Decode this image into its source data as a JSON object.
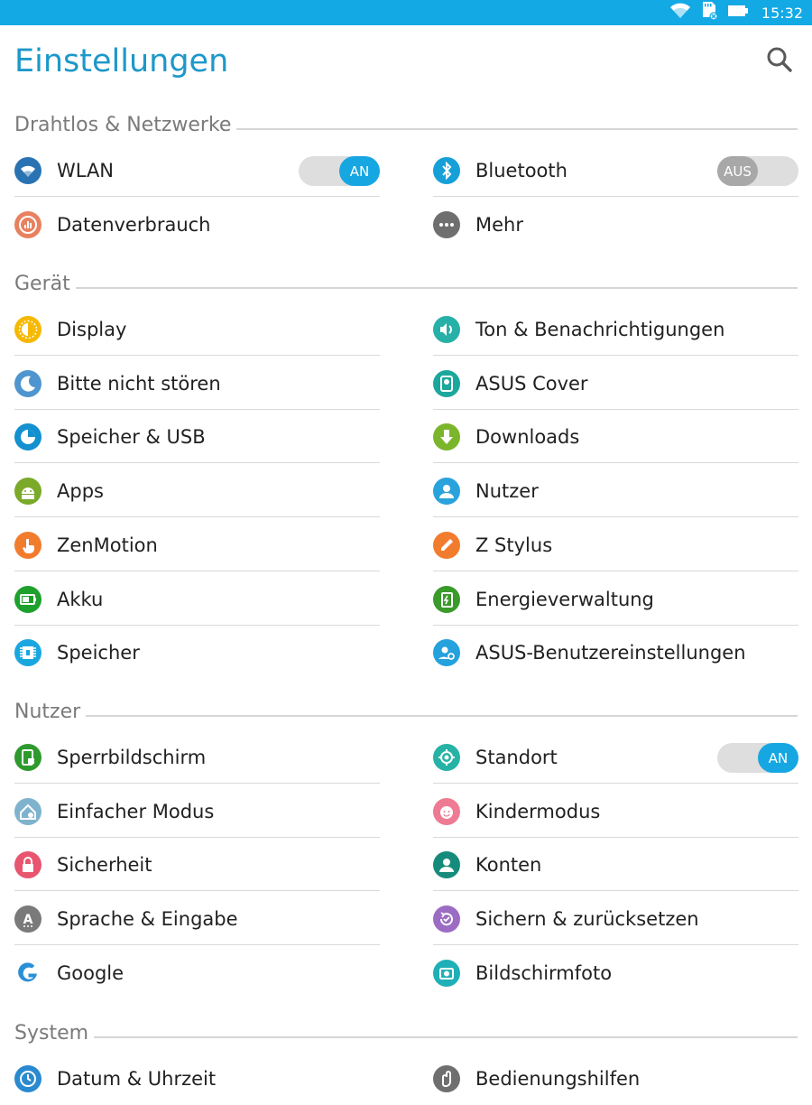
{
  "status_bar": {
    "time": "15:32",
    "icons": [
      "wifi-icon",
      "sd-card-icon",
      "battery-icon"
    ],
    "color": "#12a9e5"
  },
  "app_bar": {
    "title": "Einstellungen",
    "search_icon": "search-icon"
  },
  "sections": [
    {
      "title": "Drahtlos & Netzwerke",
      "items": [
        {
          "label": "WLAN",
          "icon": "wifi-icon",
          "color": "#2a73b3",
          "toggle": {
            "state": "on",
            "text": "AN"
          }
        },
        {
          "label": "Bluetooth",
          "icon": "bluetooth-icon",
          "color": "#16a0d7",
          "toggle": {
            "state": "off",
            "text": "AUS"
          }
        },
        {
          "label": "Datenverbrauch",
          "icon": "data-usage-icon",
          "color": "#e8815f"
        },
        {
          "label": "Mehr",
          "icon": "more-icon",
          "color": "#6f6f6f"
        }
      ]
    },
    {
      "title": "Gerät",
      "items": [
        {
          "label": "Display",
          "icon": "display-icon",
          "color": "#f6b800"
        },
        {
          "label": "Ton & Benachrichtigungen",
          "icon": "sound-icon",
          "color": "#26b0a8"
        },
        {
          "label": "Bitte nicht stören",
          "icon": "moon-icon",
          "color": "#4f95cf"
        },
        {
          "label": "ASUS Cover",
          "icon": "asus-cover-icon",
          "color": "#1ba79c"
        },
        {
          "label": "Speicher & USB",
          "icon": "storage-usb-icon",
          "color": "#1390cf"
        },
        {
          "label": "Downloads",
          "icon": "download-icon",
          "color": "#7bb52b"
        },
        {
          "label": "Apps",
          "icon": "android-icon",
          "color": "#7ba92a"
        },
        {
          "label": "Nutzer",
          "icon": "user-icon",
          "color": "#2aa2dc"
        },
        {
          "label": "ZenMotion",
          "icon": "zenmotion-icon",
          "color": "#f27c2d"
        },
        {
          "label": "Z Stylus",
          "icon": "stylus-icon",
          "color": "#f27c2d"
        },
        {
          "label": "Akku",
          "icon": "battery-icon",
          "color": "#1ea02c"
        },
        {
          "label": "Energieverwaltung",
          "icon": "power-management-icon",
          "color": "#3a9a2a"
        },
        {
          "label": "Speicher",
          "icon": "memory-chip-icon",
          "color": "#1aa7e0"
        },
        {
          "label": "ASUS-Benutzereinstellungen",
          "icon": "asus-user-settings-icon",
          "color": "#25a1de"
        }
      ]
    },
    {
      "title": "Nutzer",
      "items": [
        {
          "label": "Sperrbildschirm",
          "icon": "lock-screen-icon",
          "color": "#2e9a2e"
        },
        {
          "label": "Standort",
          "icon": "location-icon",
          "color": "#26b3a6",
          "toggle": {
            "state": "on",
            "text": "AN"
          }
        },
        {
          "label": "Einfacher Modus",
          "icon": "easy-mode-icon",
          "color": "#7fb3cd"
        },
        {
          "label": "Kindermodus",
          "icon": "kids-mode-icon",
          "color": "#ee7b93"
        },
        {
          "label": "Sicherheit",
          "icon": "lock-icon",
          "color": "#e8556f"
        },
        {
          "label": "Konten",
          "icon": "account-icon",
          "color": "#168b7c"
        },
        {
          "label": "Sprache & Eingabe",
          "icon": "language-icon",
          "color": "#7a7a7a"
        },
        {
          "label": "Sichern & zurücksetzen",
          "icon": "backup-icon",
          "color": "#9c6cc4"
        },
        {
          "label": "Google",
          "icon": "google-icon",
          "color": "#2b8fd6"
        },
        {
          "label": "Bildschirmfoto",
          "icon": "screenshot-icon",
          "color": "#1fb0b7"
        }
      ]
    },
    {
      "title": "System",
      "items": [
        {
          "label": "Datum & Uhrzeit",
          "icon": "clock-icon",
          "color": "#2a8ad0"
        },
        {
          "label": "Bedienungshilfen",
          "icon": "accessibility-icon",
          "color": "#6f6f6f"
        }
      ]
    }
  ]
}
